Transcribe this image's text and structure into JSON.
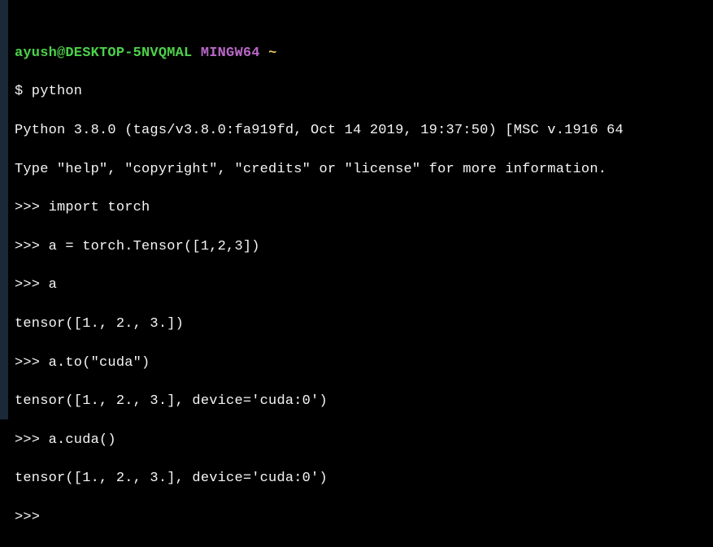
{
  "prompt": {
    "user_host": "ayush@DESKTOP-5NVQMAL",
    "env": "MINGW64",
    "path": "~"
  },
  "lines": {
    "cmd1": "$ python",
    "out1": "Python 3.8.0 (tags/v3.8.0:fa919fd, Oct 14 2019, 19:37:50) [MSC v.1916 64",
    "out2": "Type \"help\", \"copyright\", \"credits\" or \"license\" for more information.",
    "repl1": ">>> import torch",
    "repl2": ">>> a = torch.Tensor([1,2,3])",
    "repl3": ">>> a",
    "out3": "tensor([1., 2., 3.])",
    "repl4": ">>> a.to(\"cuda\")",
    "out4": "tensor([1., 2., 3.], device='cuda:0')",
    "repl5": ">>> a.cuda()",
    "out5": "tensor([1., 2., 3.], device='cuda:0')",
    "repl6": ">>> "
  }
}
